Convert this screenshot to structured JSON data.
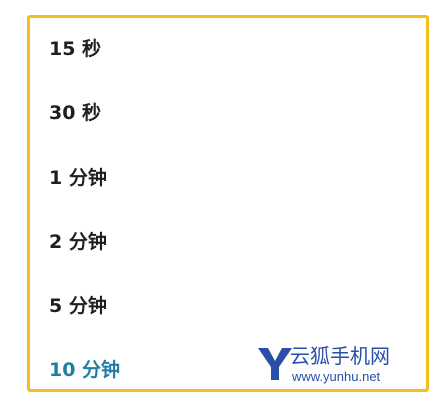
{
  "options": [
    {
      "label": "15 秒",
      "selected": false
    },
    {
      "label": "30 秒",
      "selected": false
    },
    {
      "label": "1 分钟",
      "selected": false
    },
    {
      "label": "2 分钟",
      "selected": false
    },
    {
      "label": "5 分钟",
      "selected": false
    },
    {
      "label": "10 分钟",
      "selected": true
    }
  ],
  "watermark": {
    "logo_letter": "Y",
    "name": "云狐手机网",
    "url": "www.yunhu.net"
  },
  "colors": {
    "frame_border": "#f5c01e",
    "option_text": "#1f1f1f",
    "selected_text": "#1e7fa3",
    "watermark": "#2a4fa8"
  }
}
